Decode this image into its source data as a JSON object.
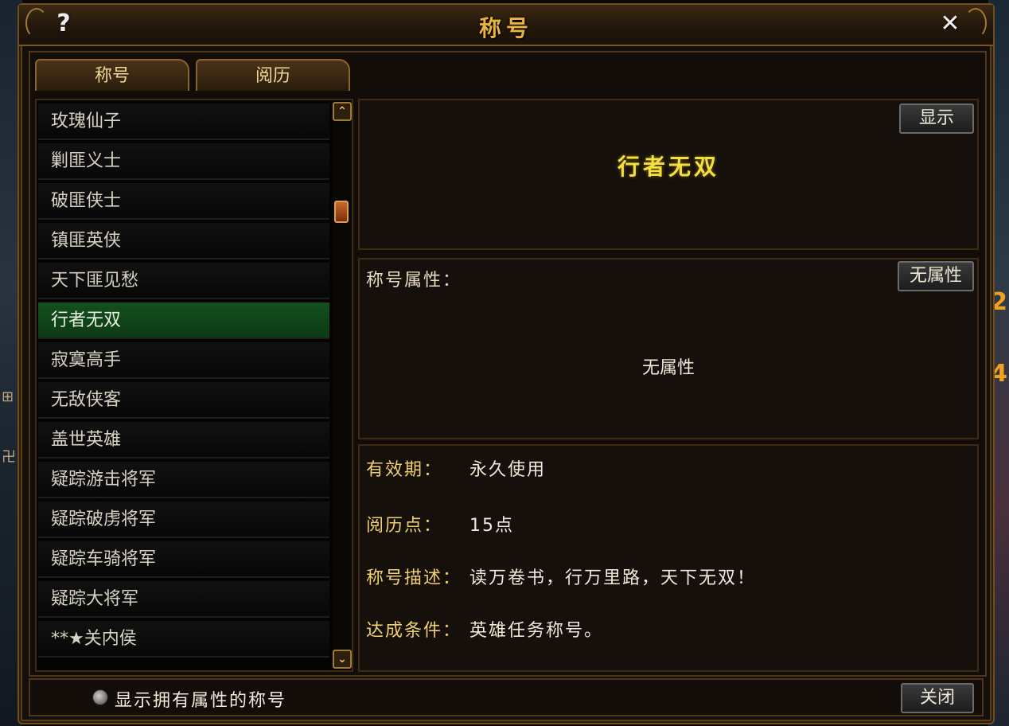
{
  "window": {
    "title": "称号",
    "help_label": "?",
    "close_label": "✕"
  },
  "tabs": [
    {
      "label": "称号"
    },
    {
      "label": "阅历"
    }
  ],
  "title_list": {
    "items": [
      "玫瑰仙子",
      "剿匪义士",
      "破匪侠士",
      "镇匪英侠",
      "天下匪见愁",
      "行者无双",
      "寂寞高手",
      "无敌侠客",
      "盖世英雄",
      "疑踪游击将军",
      "疑踪破虏将军",
      "疑踪车骑将军",
      "疑踪大将军",
      "**★关内侯"
    ],
    "selected_index": 5,
    "scroll_up": "⌃",
    "scroll_down": "⌄"
  },
  "detail": {
    "show_button": "显示",
    "title_name": "行者无双",
    "attr_label": "称号属性：",
    "attr_button": "无属性",
    "attr_value": "无属性",
    "validity_key": "有效期：",
    "validity_val": "永久使用",
    "points_key": "阅历点：",
    "points_val": "15点",
    "desc_key": "称号描述：",
    "desc_val": "读万卷书，行万里路，天下无双！",
    "cond_key": "达成条件：",
    "cond_val": "英雄任务称号。"
  },
  "footer": {
    "radio_label": "显示拥有属性的称号",
    "close_button": "关闭"
  },
  "colors": {
    "title_gold": "#e8b43c",
    "selected_row": "#14501e",
    "name_yellow": "#f2e040",
    "key_gold": "#f0d070"
  }
}
